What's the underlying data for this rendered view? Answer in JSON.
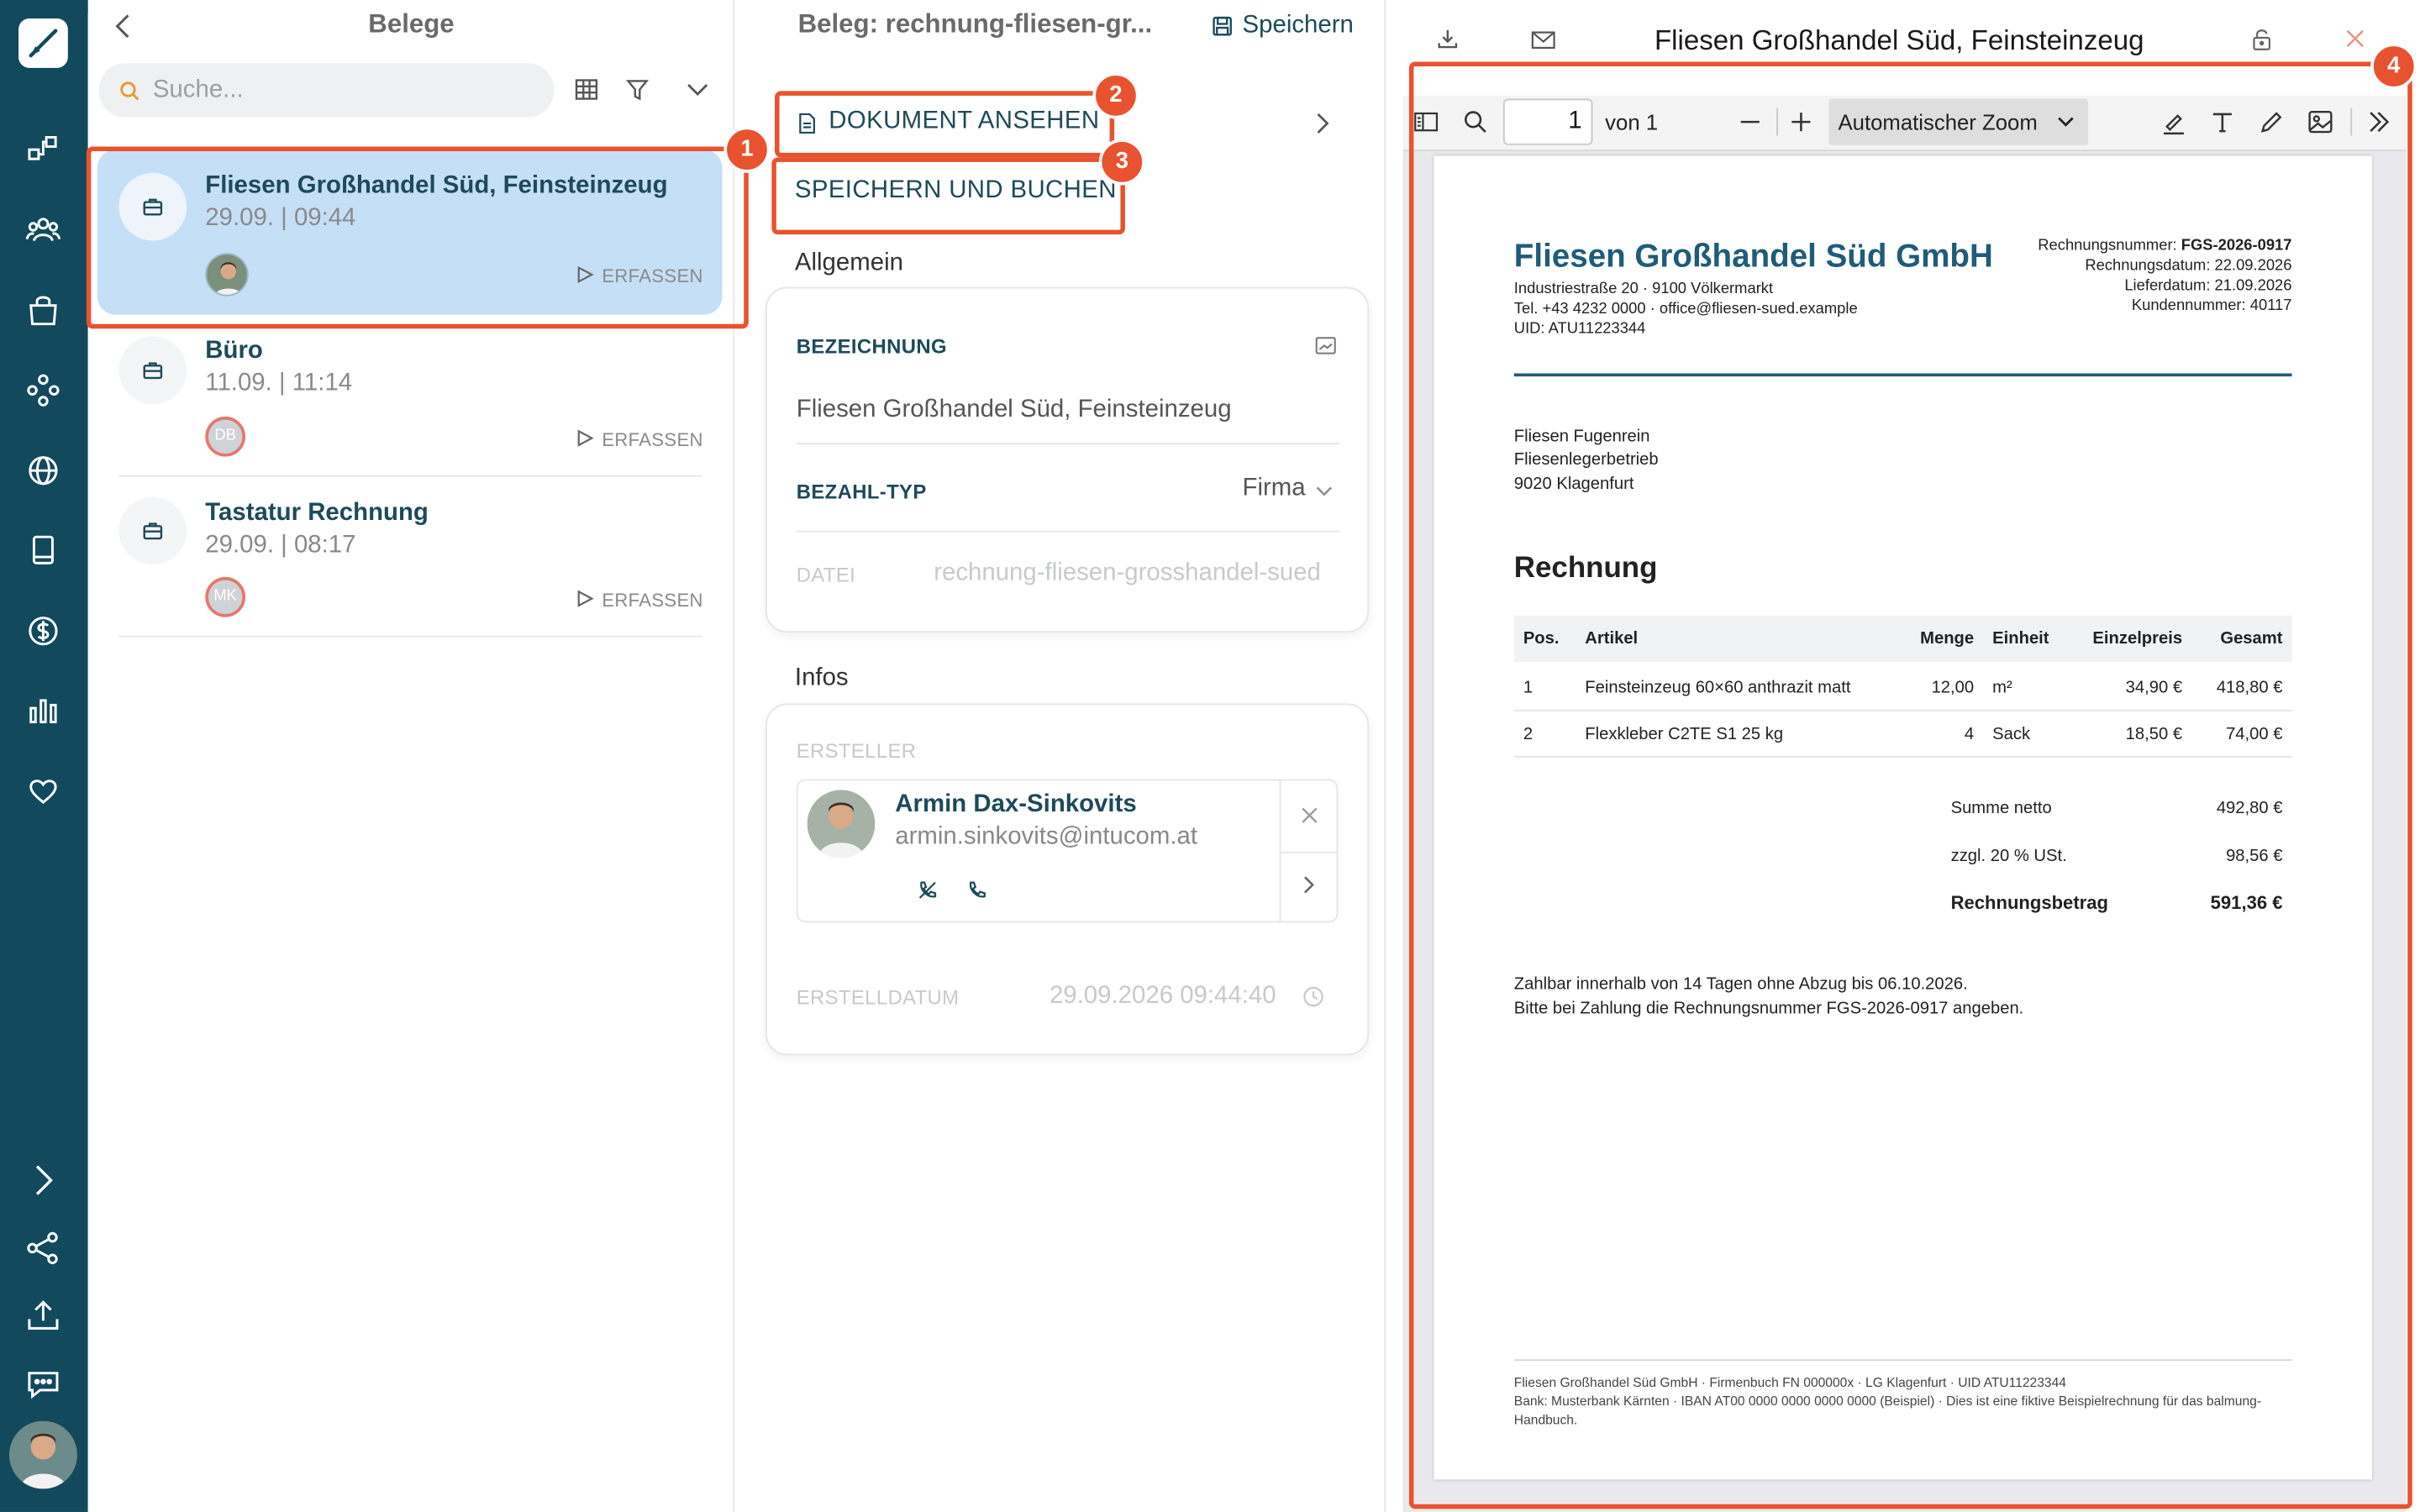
{
  "list": {
    "title": "Belege",
    "search_placeholder": "Suche...",
    "items": [
      {
        "title": "Fliesen Großhandel Süd, Feinsteinzeug",
        "date": "29.09. | 09:44",
        "action": "ERFASSEN",
        "initials": ""
      },
      {
        "title": "Büro",
        "date": "11.09. | 11:14",
        "action": "ERFASSEN",
        "initials": "DB"
      },
      {
        "title": "Tastatur Rechnung",
        "date": "29.09. | 08:17",
        "action": "ERFASSEN",
        "initials": "MK"
      }
    ]
  },
  "detail": {
    "title": "Beleg: rechnung-fliesen-gr...",
    "save_label": "Speichern",
    "view_doc_label": "DOKUMENT ANSEHEN",
    "save_book_label": "SPEICHERN UND BUCHEN",
    "section_general": "Allgemein",
    "bezeichnung_label": "BEZEICHNUNG",
    "bezeichnung_value": "Fliesen Großhandel Süd, Feinsteinzeug",
    "bezahltyp_label": "BEZAHL-TYP",
    "bezahltyp_value": "Firma",
    "datei_label": "DATEI",
    "datei_value": "rechnung-fliesen-grosshandel-sued",
    "section_infos": "Infos",
    "ersteller_label": "ERSTELLER",
    "creator_name": "Armin Dax-Sinkovits",
    "creator_email": "armin.sinkovits@intucom.at",
    "erstelldatum_label": "ERSTELLDATUM",
    "erstelldatum_value": "29.09.2026 09:44:40"
  },
  "viewer": {
    "title": "Fliesen Großhandel Süd, Feinsteinzeug",
    "page_number": "1",
    "page_of": "von 1",
    "zoom": "Automatischer Zoom"
  },
  "invoice": {
    "company": "Fliesen Großhandel Süd GmbH",
    "addr1": "Industriestraße 20 · 9100 Völkermarkt",
    "addr2": "Tel. +43 4232 0000 · office@fliesen-sued.example",
    "addr3": "UID: ATU11223344",
    "meta": [
      {
        "label": "Rechnungsnummer: ",
        "value": "FGS-2026-0917"
      },
      {
        "label": "Rechnungsdatum: ",
        "value": "22.09.2026"
      },
      {
        "label": "Lieferdatum: ",
        "value": "21.09.2026"
      },
      {
        "label": "Kundennummer: ",
        "value": "40117"
      }
    ],
    "recipient1": "Fliesen Fugenrein",
    "recipient2": "Fliesenlegerbetrieb",
    "recipient3": "9020 Klagenfurt",
    "heading": "Rechnung",
    "columns": [
      "Pos.",
      "Artikel",
      "Menge",
      "Einheit",
      "Einzelpreis",
      "Gesamt"
    ],
    "rows": [
      [
        "1",
        "Feinsteinzeug 60×60 anthrazit matt",
        "12,00",
        "m²",
        "34,90 €",
        "418,80 €"
      ],
      [
        "2",
        "Flexkleber C2TE S1 25 kg",
        "4",
        "Sack",
        "18,50 €",
        "74,00 €"
      ]
    ],
    "net_label": "Summe netto",
    "net_value": "492,80 €",
    "vat_label": "zzgl. 20 % USt.",
    "vat_value": "98,56 €",
    "total_label": "Rechnungsbetrag",
    "total_value": "591,36 €",
    "note1": "Zahlbar innerhalb von 14 Tagen ohne Abzug bis 06.10.2026.",
    "note2": "Bitte bei Zahlung die Rechnungsnummer FGS-2026-0917 angeben.",
    "footer1": "Fliesen Großhandel Süd GmbH · Firmenbuch FN 000000x · LG Klagenfurt · UID ATU11223344",
    "footer2": "Bank: Musterbank Kärnten · IBAN AT00 0000 0000 0000 0000 (Beispiel) · Dies ist eine fiktive Beispielrechnung für das balmung-",
    "footer3": "Handbuch."
  },
  "badges": [
    "1",
    "2",
    "3",
    "4"
  ],
  "colors": {
    "rail": "#12495c",
    "accent": "#e9522f",
    "selected": "#c5dff7",
    "text_dark": "#1e4a5a"
  }
}
